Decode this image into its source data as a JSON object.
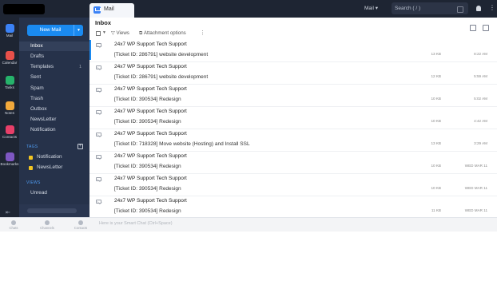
{
  "topbar": {
    "app_tab_label": "Mail",
    "search_scope": "Mail ▾",
    "search_placeholder": "Search ( / )"
  },
  "rail": {
    "items": [
      {
        "label": "Mail",
        "color": "#3b82f6"
      },
      {
        "label": "Calendar",
        "color": "#e8504a"
      },
      {
        "label": "Tasks",
        "color": "#26b36b"
      },
      {
        "label": "Notes",
        "color": "#f2a93b"
      },
      {
        "label": "Contacts",
        "color": "#e83f68"
      },
      {
        "label": "Bookmarks",
        "color": "#7e57c2"
      }
    ]
  },
  "folders": {
    "new_mail_label": "New Mail",
    "items": [
      {
        "label": "Inbox"
      },
      {
        "label": "Drafts"
      },
      {
        "label": "Templates",
        "count": "1"
      },
      {
        "label": "Sent"
      },
      {
        "label": "Spam"
      },
      {
        "label": "Trash"
      },
      {
        "label": "Outbox"
      },
      {
        "label": "NewsLetter"
      },
      {
        "label": "Notification"
      }
    ],
    "tags_label": "TAGS",
    "tags": [
      {
        "label": "Notification",
        "color": "#f2c522"
      },
      {
        "label": "NewsLetter",
        "color": "#f2c522"
      }
    ],
    "views_label": "VIEWS",
    "views": [
      {
        "label": "Unread"
      }
    ]
  },
  "bottombar": {
    "items": [
      {
        "label": "Chats"
      },
      {
        "label": "Channels"
      },
      {
        "label": "Contacts"
      }
    ],
    "smart_chat_placeholder": "Here is your Smart Chat (Ctrl+Space)"
  },
  "main": {
    "title": "Inbox",
    "toolbar": {
      "views_label": "Views",
      "attachment_label": "Attachment options",
      "more": "⋮"
    },
    "emails": [
      {
        "from": "24x7 WP Support Tech Support",
        "subject": "[Ticket ID: 286791] website development",
        "size": "13 KB",
        "time": "8:22 AM"
      },
      {
        "from": "24x7 WP Support Tech Support",
        "subject": "[Ticket ID: 286791] website development",
        "size": "12 KB",
        "time": "5:59 AM"
      },
      {
        "from": "24x7 WP Support Tech Support",
        "subject": "[Ticket ID: 390534] Redesign",
        "size": "10 KB",
        "time": "5:02 AM"
      },
      {
        "from": "24x7 WP Support Tech Support",
        "subject": "[Ticket ID: 390534] Redesign",
        "size": "10 KB",
        "time": "4:42 AM"
      },
      {
        "from": "24x7 WP Support Tech Support",
        "subject": "[Ticket ID: 718328] Move website (Hosting) and Install SSL",
        "size": "13 KB",
        "time": "3:29 AM"
      },
      {
        "from": "24x7 WP Support Tech Support",
        "subject": "[Ticket ID: 390534] Redesign",
        "size": "10 KB",
        "time": "WED MAR 11"
      },
      {
        "from": "24x7 WP Support Tech Support",
        "subject": "[Ticket ID: 390534] Redesign",
        "size": "10 KB",
        "time": "WED MAR 11"
      },
      {
        "from": "24x7 WP Support Tech Support",
        "subject": "[Ticket ID: 390534] Redesign",
        "size": "11 KB",
        "time": "WED MAR 11"
      }
    ]
  }
}
